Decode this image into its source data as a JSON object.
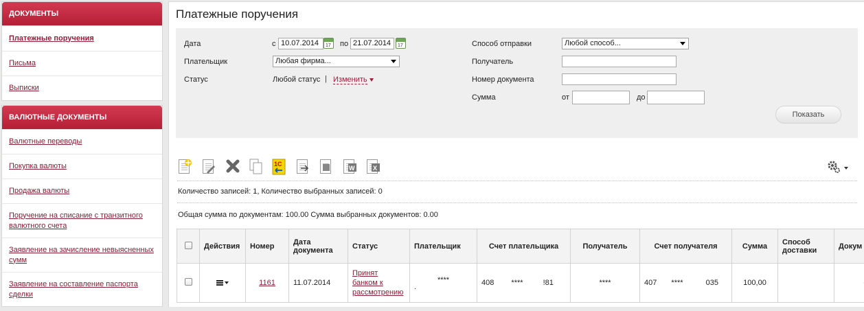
{
  "sidebar": {
    "documents": {
      "title": "ДОКУМЕНТЫ",
      "items": [
        "Платежные поручения",
        "Письма",
        "Выписки"
      ]
    },
    "currency": {
      "title": "ВАЛЮТНЫЕ ДОКУМЕНТЫ",
      "items": [
        "Валютные переводы",
        "Покупка валюты",
        "Продажа валюты",
        "Поручение на списание с транзитного валютного счета",
        "Заявление на зачисление невыясненных сумм",
        "Заявление на составление паспорта сделки"
      ]
    }
  },
  "page": {
    "title": "Платежные поручения"
  },
  "filter": {
    "date_label": "Дата",
    "date_from_prefix": "с",
    "date_from": "10.07.2014",
    "date_to_prefix": "по",
    "date_to": "21.07.2014",
    "payer_label": "Плательщик",
    "payer_value": "Любая фирма...",
    "status_label": "Статус",
    "status_value": "Любой статус",
    "status_sep": "|",
    "status_change": "Изменить",
    "send_method_label": "Способ отправки",
    "send_method_value": "Любой способ...",
    "recipient_label": "Получатель",
    "recipient_value": "",
    "doc_number_label": "Номер документа",
    "doc_number_value": "",
    "sum_label": "Сумма",
    "sum_from_label": "от",
    "sum_from_value": "",
    "sum_to_label": "до",
    "sum_to_value": "",
    "show_button": "Показать",
    "calendar_day": "17"
  },
  "summary": {
    "records": "Количество записей: 1, Количество выбранных записей: 0",
    "totals": "Общая сумма по документам: 100.00 Сумма выбранных документов: 0.00"
  },
  "table": {
    "headers": [
      "Действия",
      "Номер",
      "Дата документа",
      "Статус",
      "Плательщик",
      "Счет плательщика",
      "Получатель",
      "Счет получателя",
      "Сумма",
      "Способ доставки",
      "Докум"
    ],
    "rows": [
      {
        "number": "1161",
        "date": "11.07.2014",
        "status": "Принят банком к рассмотрению",
        "payer": "****",
        "payer_dot": ".",
        "payer_account_a": "408",
        "payer_account_b": "****",
        "payer_account_c": "!81",
        "recipient": "****",
        "recipient_account_a": "407",
        "recipient_account_b": "****",
        "recipient_account_c": "035",
        "sum": "100,00",
        "delivery": "",
        "doc": "-"
      }
    ]
  }
}
